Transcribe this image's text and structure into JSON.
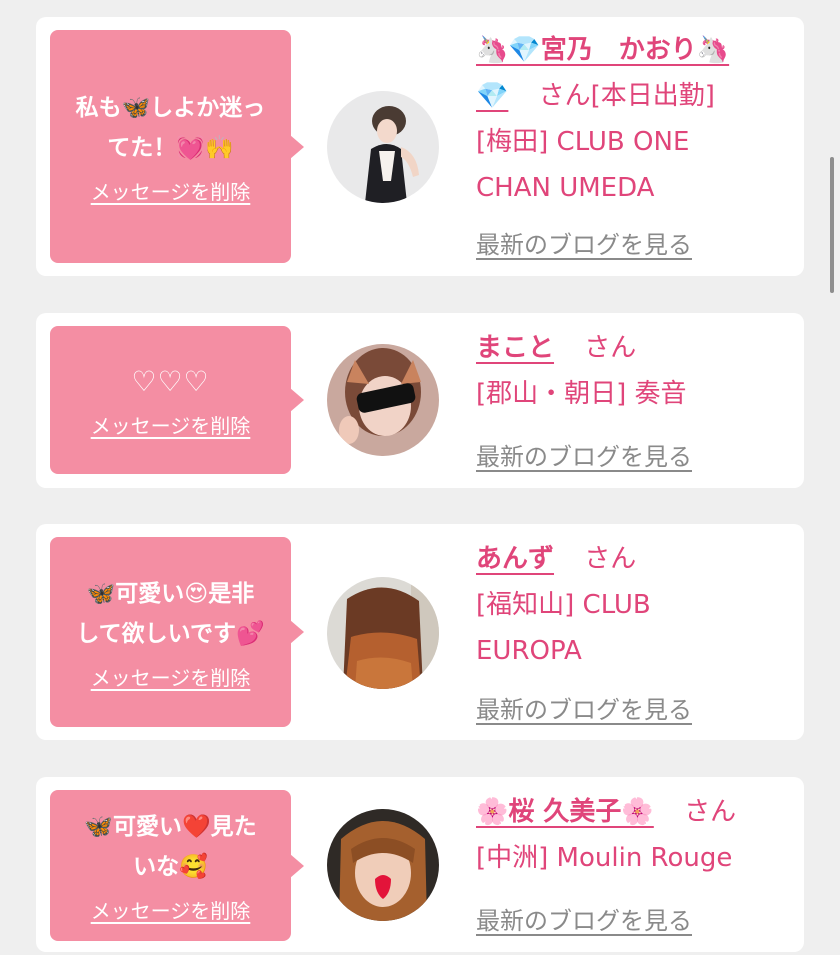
{
  "delete_label": "メッセージを削除",
  "blog_label": "最新のブログを見る",
  "honorific": "さん",
  "colors": {
    "page_bg": "#efefef",
    "bubble_bg": "#f48ea3",
    "accent": "#e0457a",
    "muted_link": "#8a8a8a"
  },
  "messages": [
    {
      "bubble_line1": "私も🦋しよか迷っ",
      "bubble_line2": "てた！💓🙌",
      "name_part1": "🦄💎宮乃　かおり🦄",
      "name_part2": "💎",
      "honorific_suffix": "さん[本日出勤]",
      "shop_line1": "[梅田] CLUB ONE",
      "shop_line2": "CHAN UMEDA"
    },
    {
      "bubble_line1": "♡♡♡",
      "name": "まこと",
      "shop_line1": "[郡山・朝日] 奏音"
    },
    {
      "bubble_line1": "🦋可愛い😍是非",
      "bubble_line2": "して欲しいです💕",
      "name": "あんず",
      "shop_line1": "[福知山] CLUB",
      "shop_line2": "EUROPA"
    },
    {
      "bubble_line1": "🦋可愛い❤️見た",
      "bubble_line2": "いな🥰",
      "name": "🌸桜 久美子🌸",
      "shop_line1": "[中洲] Moulin Rouge"
    }
  ]
}
